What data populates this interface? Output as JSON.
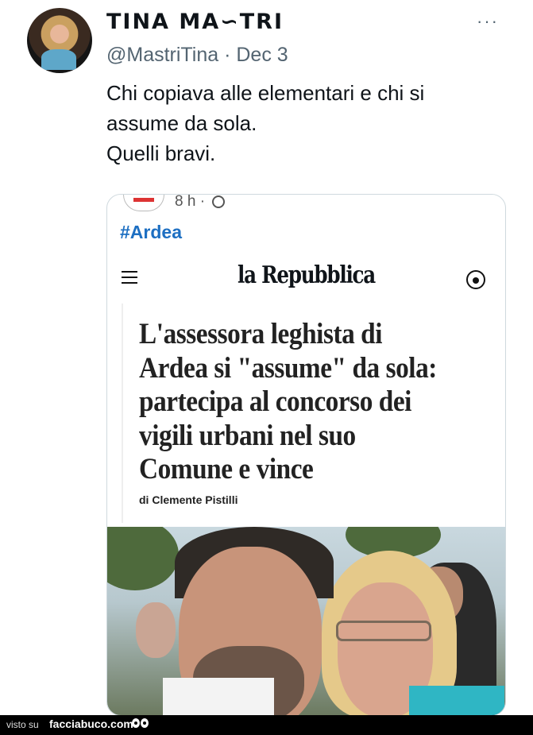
{
  "tweet": {
    "display_name": "TINA MA∽TRI",
    "handle_line": "@MastriTina · Dec 3",
    "more_label": "···",
    "text_lines": [
      "Chi copiava alle elementari e chi si",
      "assume da sola.",
      "Quelli bravi."
    ]
  },
  "embedded": {
    "time": "8 h ·",
    "hashtag": "#Ardea",
    "brand": "la Repubblica",
    "headline_lines": [
      "L'assessora leghista di",
      "Ardea si \"assume\" da sola:",
      "partecipa al concorso dei",
      "vigili urbani nel suo",
      "Comune e vince"
    ],
    "byline": "di Clemente Pistilli"
  },
  "footer": {
    "visto": "visto su",
    "site": "facciabuco.com"
  }
}
